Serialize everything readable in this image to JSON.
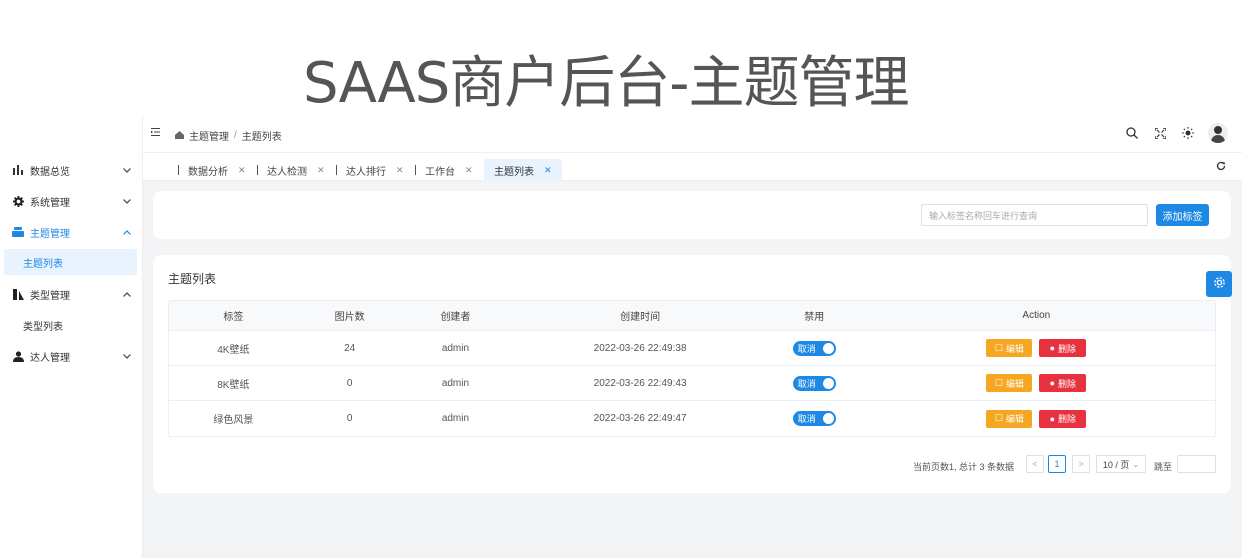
{
  "banner": {
    "title": "SAAS商户后台-主题管理"
  },
  "sidebar": {
    "items": [
      {
        "label": "数据总览",
        "icon": "bar-chart-icon",
        "chevron": "⌄"
      },
      {
        "label": "系统管理",
        "icon": "gear-icon",
        "chevron": "⌄"
      },
      {
        "label": "主题管理",
        "icon": "layers-icon",
        "chevron": "⌃"
      },
      {
        "label": "类型管理",
        "icon": "type-icon",
        "chevron": "⌃"
      },
      {
        "label": "达人管理",
        "icon": "users-icon",
        "chevron": "⌄"
      }
    ],
    "subitems": {
      "theme_list": "主题列表",
      "type_list": "类型列表"
    }
  },
  "topbar": {
    "breadcrumb": [
      "主题管理",
      "主题列表"
    ],
    "separator": "/"
  },
  "tabs": [
    {
      "label": "数据分析"
    },
    {
      "label": "达人检测"
    },
    {
      "label": "达人排行"
    },
    {
      "label": "工作台"
    },
    {
      "label": "主题列表",
      "active": true
    }
  ],
  "search": {
    "placeholder": "输入标签名称回车进行查询",
    "add_label": "添加标签"
  },
  "table": {
    "title": "主题列表",
    "headers": [
      "标签",
      "图片数",
      "创建者",
      "创建时间",
      "禁用",
      "Action"
    ],
    "rows": [
      {
        "tag": "4K壁纸",
        "count": "24",
        "creator": "admin",
        "time": "2022-03-26 22:49:38",
        "toggle": "取消"
      },
      {
        "tag": "8K壁纸",
        "count": "0",
        "creator": "admin",
        "time": "2022-03-26 22:49:43",
        "toggle": "取消"
      },
      {
        "tag": "绿色风景",
        "count": "0",
        "creator": "admin",
        "time": "2022-03-26 22:49:47",
        "toggle": "取消"
      }
    ],
    "edit_label": "编辑",
    "delete_label": "删除"
  },
  "pagination": {
    "total_text": "当前页数1, 总计 3 条数据",
    "prev": "<",
    "page": "1",
    "next": ">",
    "page_size": "10 / 页",
    "jump_label": "跳至"
  },
  "colors": {
    "primary": "#1e88e5",
    "edit": "#f5a623",
    "delete": "#e8313f"
  }
}
